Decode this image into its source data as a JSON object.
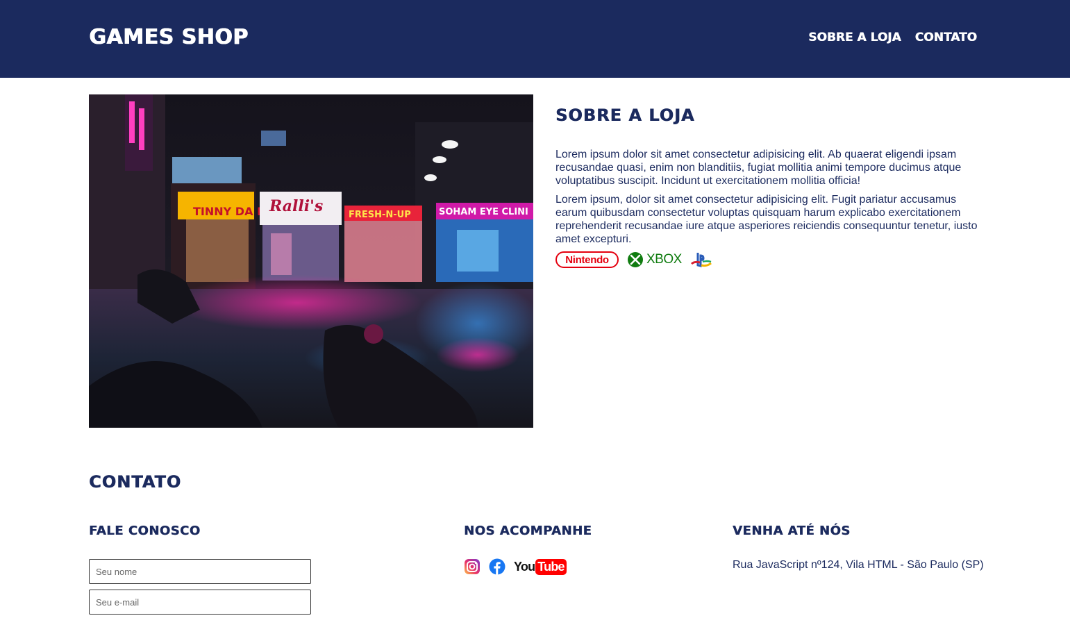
{
  "header": {
    "brand": "GAMES SHOP",
    "nav": [
      "SOBRE A LOJA",
      "CONTATO"
    ]
  },
  "about": {
    "title": "SOBRE A LOJA",
    "paragraphs": [
      "Lorem ipsum dolor sit amet consectetur adipisicing elit. Ab quaerat eligendi ipsam recusandae quasi, enim non blanditiis, fugiat mollitia animi tempore ducimus atque voluptatibus suscipit. Incidunt ut exercitationem mollitia officia!",
      "Lorem ipsum, dolor sit amet consectetur adipisicing elit. Fugit pariatur accusamus earum quibusdam consectetur voluptas quisquam harum explicabo exercitationem reprehenderit recusandae iure atque asperiores reiciendis consequuntur tenetur, iusto amet excepturi."
    ],
    "platforms": {
      "nintendo": "Nintendo",
      "xbox": "XBOX",
      "playstation_icon": "playstation-logo-icon"
    },
    "photo_signs": [
      "TINNY DA DHABA",
      "Ralli's",
      "FRESH-N-UP",
      "SOHAM EYE CLINI"
    ]
  },
  "contact": {
    "title": "CONTATO",
    "form": {
      "title": "FALE CONOSCO",
      "name_placeholder": "Seu nome",
      "email_placeholder": "Seu e-mail"
    },
    "social": {
      "title": "NOS ACOMPANHE",
      "icons": [
        "instagram-icon",
        "facebook-icon",
        "youtube-icon"
      ],
      "youtube_text": "You",
      "youtube_tube": "Tube"
    },
    "visit": {
      "title": "VENHA ATÉ NÓS",
      "address": "Rua JavaScript nº124, Vila HTML - São Paulo (SP)"
    }
  },
  "colors": {
    "primary": "#1b2a5e",
    "background": "#ffffff",
    "nintendo_red": "#e4000f",
    "xbox_green": "#107c10",
    "youtube_red": "#ff0000"
  }
}
